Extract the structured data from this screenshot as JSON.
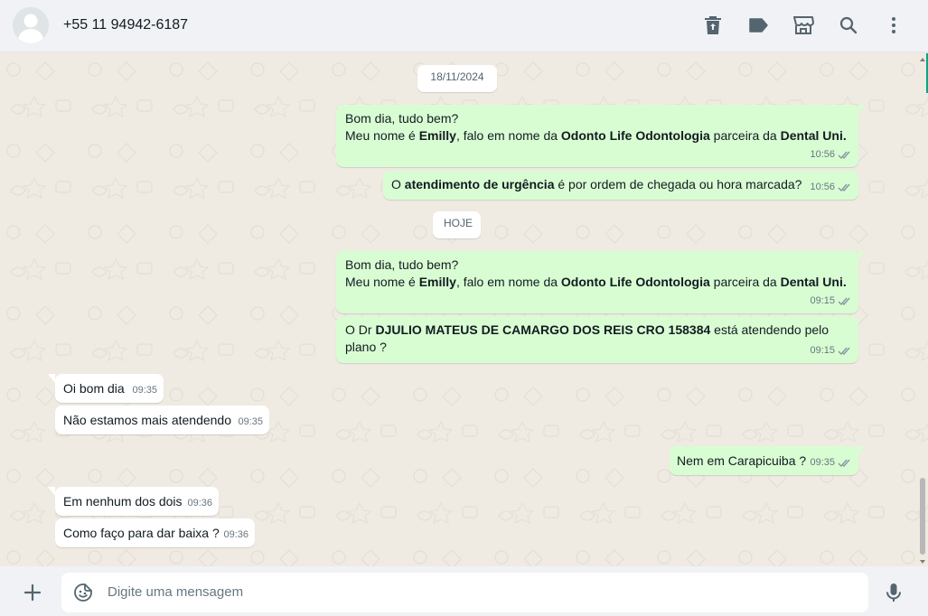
{
  "header": {
    "contact_name": "+55 11 94942-6187",
    "icons": [
      "delete-icon",
      "label-icon",
      "store-icon",
      "search-icon",
      "menu-icon"
    ]
  },
  "chat": {
    "date_1": "18/11/2024",
    "date_2": "HOJE",
    "messages": [
      {
        "dir": "out",
        "line1": "Bom dia, tudo bem?",
        "line2_pre": "Meu nome é ",
        "name": "Emilly",
        "line2_mid": ", falo em nome da ",
        "company": "Odonto Life Odontologia",
        "line2_mid2": " parceira da ",
        "partner": "Dental Uni.",
        "time": "10:56"
      },
      {
        "dir": "out",
        "pre": "O ",
        "bold": "atendimento de urgência",
        "post": " é por ordem de chegada ou hora marcada?",
        "time": "10:56"
      },
      {
        "dir": "out",
        "line1": "Bom dia, tudo bem?",
        "line2_pre": "Meu nome é ",
        "name": "Emilly",
        "line2_mid": ", falo em nome da ",
        "company": "Odonto Life Odontologia",
        "line2_mid2": " parceira da ",
        "partner": "Dental Uni.",
        "time": "09:15"
      },
      {
        "dir": "out",
        "pre": "O Dr ",
        "bold": "DJULIO MATEUS DE CAMARGO DOS REIS CRO 158384",
        "post": " está atendendo pelo",
        "line2": "plano ?",
        "time": "09:15"
      },
      {
        "dir": "in",
        "text": "Oi bom dia",
        "time": "09:35"
      },
      {
        "dir": "in",
        "text": "Não estamos mais atendendo",
        "time": "09:35"
      },
      {
        "dir": "out",
        "text": "Nem em Carapicuiba ?",
        "time": "09:35"
      },
      {
        "dir": "in",
        "text": "Em nenhum dos dois",
        "time": "09:36"
      },
      {
        "dir": "in",
        "text": "Como faço para dar baixa ?",
        "time": "09:36"
      }
    ]
  },
  "footer": {
    "placeholder": "Digite uma mensagem"
  },
  "colors": {
    "outgoing_bubble": "#d9fdd3",
    "incoming_bubble": "#ffffff",
    "chat_background": "#efeae2",
    "read_ticks": "#8696a0"
  }
}
